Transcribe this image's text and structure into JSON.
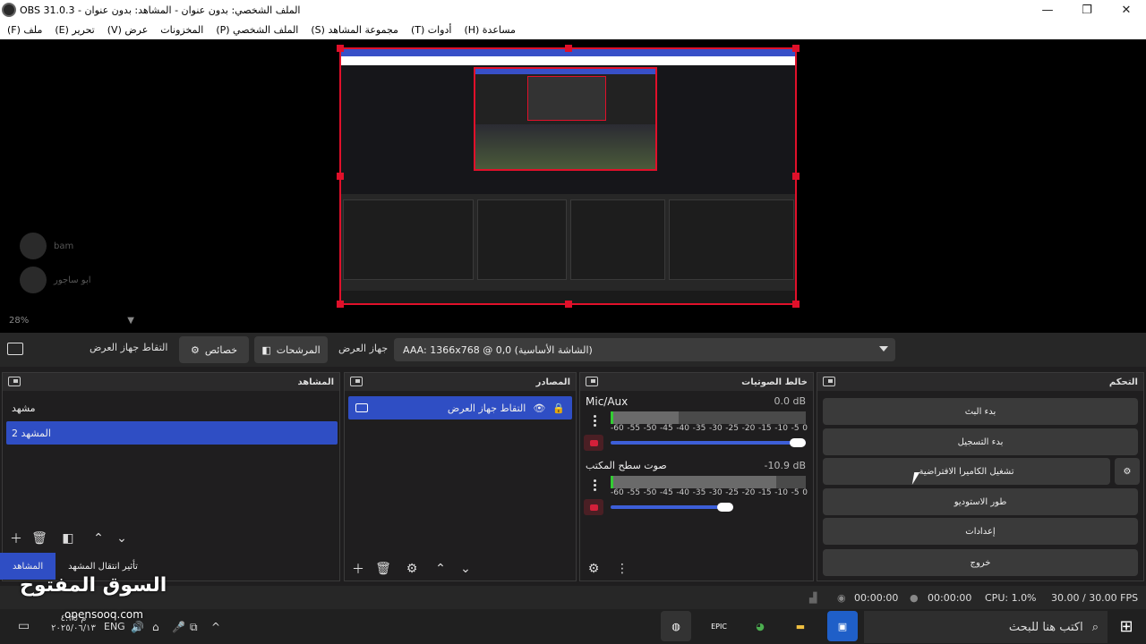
{
  "window": {
    "title": "OBS 31.0.3 - الملف الشخصي: بدون عنوان - المشاهد: بدون عنوان",
    "minimize": "—",
    "restore": "❐",
    "close": "✕"
  },
  "menu": [
    "(F) ملف",
    "(E) تحرير",
    "(V) عرض",
    "المخزونات",
    "(P) الملف الشخصي",
    "(S) مجموعة المشاهد",
    "(T) أدوات",
    "(H) مساعدة"
  ],
  "preview": {
    "zoom": "28%",
    "ghost_names": [
      "bam",
      "ابو ساجور"
    ]
  },
  "source_toolbar": {
    "source_name": "التقاط جهاز العرض",
    "properties": "خصائص",
    "filters": "المرشحات",
    "display_label": "جهاز العرض",
    "display_value": "AAA: 1366x768 @ 0,0 (الشاشة الأساسية)"
  },
  "scenes": {
    "title": "المشاهد",
    "items": [
      "مشهد",
      "المشهد 2"
    ],
    "selected_index": 1,
    "tabs": [
      "المشاهد",
      "تأثير انتقال المشهد"
    ]
  },
  "sources": {
    "title": "المصادر",
    "items": [
      {
        "name": "التقاط جهاز العرض",
        "visible": true,
        "locked": true
      }
    ]
  },
  "mixer": {
    "title": "خالط الصوتيات",
    "channels": [
      {
        "name": "Mic/Aux",
        "db": "0.0 dB",
        "volume": 1.0,
        "level": 0.35
      },
      {
        "name": "صوت سطح المكتب",
        "db": "-10.9 dB",
        "volume": 0.63,
        "level": 0.85
      }
    ],
    "scale": [
      "-60",
      "-55",
      "-50",
      "-45",
      "-40",
      "-35",
      "-30",
      "-25",
      "-20",
      "-15",
      "-10",
      "-5",
      "0"
    ]
  },
  "controls": {
    "title": "التحكم",
    "buttons": [
      "بدء البث",
      "بدء التسجيل",
      "تشغيل الكاميرا الافتراضية",
      "طور الاستوديو",
      "إعدادات",
      "خروج"
    ]
  },
  "status": {
    "time1": "00:00:00",
    "time2": "00:00:00",
    "cpu": "CPU: 1.0%",
    "fps": "30.00 / 30.00 FPS"
  },
  "taskbar": {
    "search_placeholder": "اكتب هنا للبحث",
    "lang": "ENG",
    "date": "٢٠٢٥/٠٦/١٣",
    "time": "م ٤:٢٥"
  },
  "watermark": {
    "main": "السوق المفتوح",
    "sub": "opensooq.com"
  }
}
